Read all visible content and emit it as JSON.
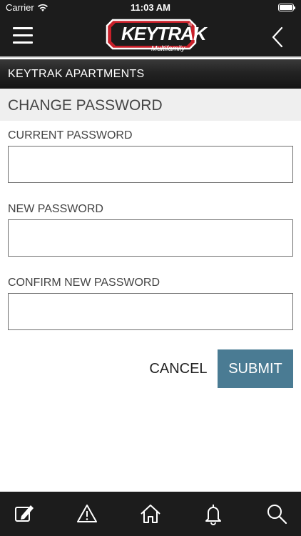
{
  "status_bar": {
    "carrier": "Carrier",
    "time": "11:03 AM",
    "wifi_icon": "wifi-icon",
    "battery_icon": "battery-icon",
    "battery_level": 1.0
  },
  "nav": {
    "menu_icon": "hamburger-menu-icon",
    "logo_text": "KEYTRAK",
    "logo_subtitle": "Multifamily",
    "logo_mark": "®",
    "back_icon": "chevron-left-icon"
  },
  "property": {
    "name": "KEYTRAK APARTMENTS"
  },
  "page": {
    "title": "CHANGE PASSWORD"
  },
  "form": {
    "current_password": {
      "label": "CURRENT PASSWORD",
      "value": ""
    },
    "new_password": {
      "label": "NEW PASSWORD",
      "value": ""
    },
    "confirm_password": {
      "label": "CONFIRM NEW PASSWORD",
      "value": ""
    },
    "cancel_label": "CANCEL",
    "submit_label": "SUBMIT"
  },
  "tab_bar": {
    "items": [
      {
        "name": "edit",
        "icon": "edit-icon"
      },
      {
        "name": "alerts",
        "icon": "warning-icon"
      },
      {
        "name": "home",
        "icon": "home-icon"
      },
      {
        "name": "notifications",
        "icon": "bell-icon"
      },
      {
        "name": "search",
        "icon": "search-icon"
      }
    ]
  },
  "colors": {
    "bar_background": "#1c1c1c",
    "submit_button": "#4a7b93",
    "section_header": "#efefef",
    "logo_red": "#c8202a"
  }
}
